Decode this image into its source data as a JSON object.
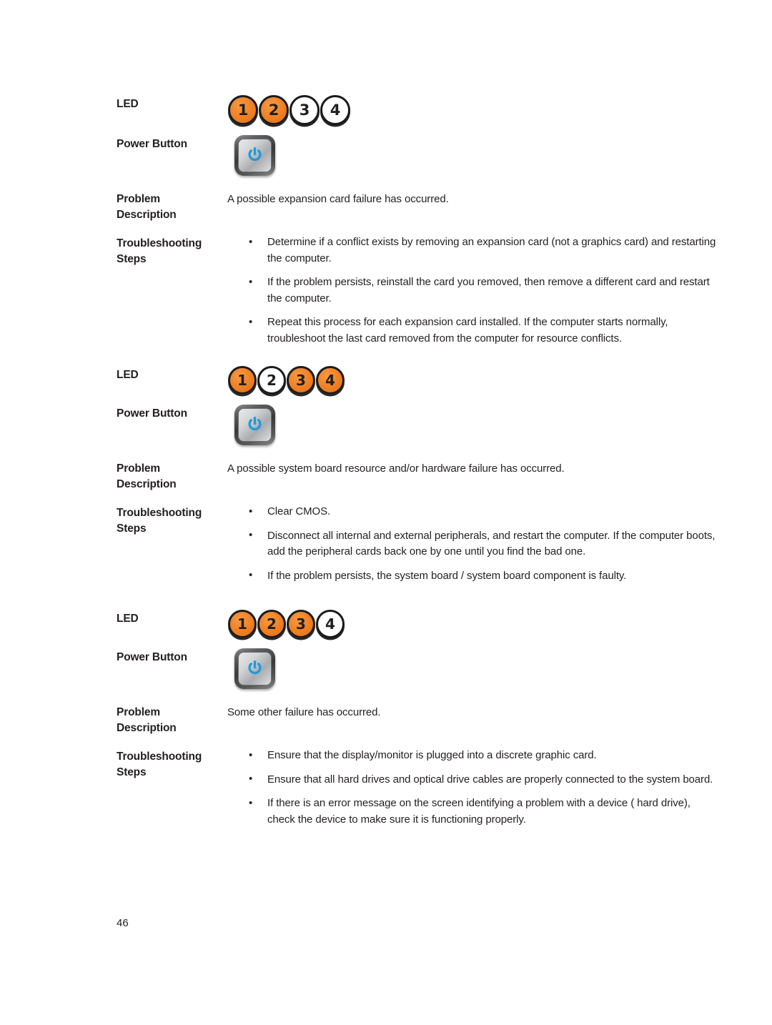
{
  "document": {
    "page_number": "46",
    "labels": {
      "led": "LED",
      "power_button": "Power Button",
      "problem_line1": "Problem",
      "problem_line2": "Description",
      "steps_line1": "Troubleshooting",
      "steps_line2": "Steps"
    },
    "colors": {
      "led_on": "#ef7f22",
      "led_off": "#ffffff",
      "led_ring": "#1b1b1b",
      "power_glyph": "#1f9bd8",
      "text": "#231f20"
    },
    "icons": {
      "power": "power-symbol-icon",
      "led_on": "led-indicator-on-icon",
      "led_off": "led-indicator-off-icon"
    },
    "blocks": [
      {
        "leds": [
          {
            "number": "1",
            "state": "on"
          },
          {
            "number": "2",
            "state": "on"
          },
          {
            "number": "3",
            "state": "off"
          },
          {
            "number": "4",
            "state": "off"
          }
        ],
        "description": "A possible expansion card failure has occurred.",
        "steps": [
          "Determine if a conflict exists by removing an expansion card (not a graphics card) and restarting the computer.",
          "If the problem persists, reinstall the card you removed, then remove a different card and restart the computer.",
          "Repeat this process for each expansion card installed. If the computer starts normally, troubleshoot the last card removed from the computer for resource conflicts."
        ]
      },
      {
        "leds": [
          {
            "number": "1",
            "state": "on"
          },
          {
            "number": "2",
            "state": "off"
          },
          {
            "number": "3",
            "state": "on"
          },
          {
            "number": "4",
            "state": "on"
          }
        ],
        "description": "A possible system board resource and/or hardware failure has occurred.",
        "steps": [
          "Clear CMOS.",
          "Disconnect all internal and external peripherals, and restart the computer. If the computer boots, add the peripheral cards back one by one until you find the bad one.",
          "If the problem persists, the system board / system board component is faulty."
        ]
      },
      {
        "leds": [
          {
            "number": "1",
            "state": "on"
          },
          {
            "number": "2",
            "state": "on"
          },
          {
            "number": "3",
            "state": "on"
          },
          {
            "number": "4",
            "state": "off"
          }
        ],
        "description": "Some other failure has occurred.",
        "steps": [
          "Ensure that the display/monitor is plugged into a discrete graphic card.",
          "Ensure that all hard drives and optical drive cables are properly connected to the system board.",
          "If there is an error message on the screen identifying a problem with a device ( hard drive), check the device to make sure it is functioning properly."
        ]
      }
    ]
  }
}
